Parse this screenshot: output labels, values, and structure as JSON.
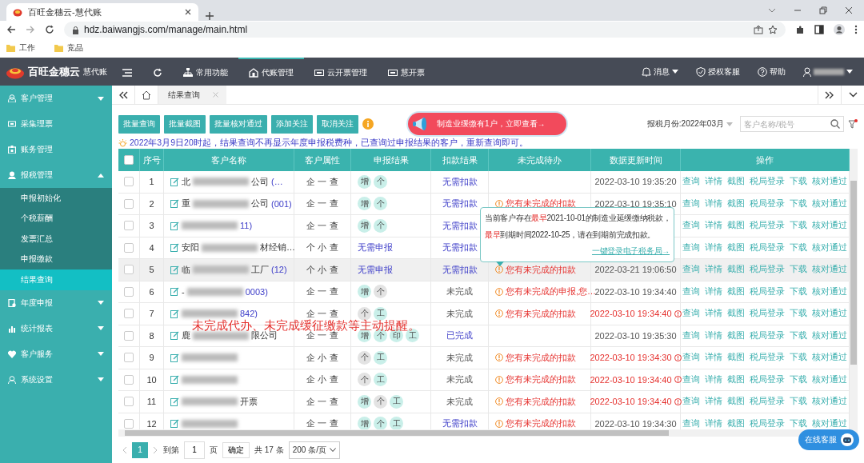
{
  "browser": {
    "tab_title": "百旺金穗云-慧代账",
    "url": "hdz.baiwangjs.com/manage/main.html",
    "bookmarks": [
      "工作",
      "竞品"
    ]
  },
  "header": {
    "brand": "百旺金穗云",
    "product": "慧代账",
    "nav": [
      {
        "label": "常用功能",
        "selected": false
      },
      {
        "label": "代账管理",
        "selected": true
      },
      {
        "label": "云开票管理",
        "selected": false
      },
      {
        "label": "慧开票",
        "selected": false
      }
    ],
    "right": [
      "消息",
      "授权客服",
      "帮助"
    ]
  },
  "sidebar": {
    "items": [
      {
        "label": "客户管理",
        "kind": "group",
        "expanded": false
      },
      {
        "label": "采集理票",
        "kind": "link"
      },
      {
        "label": "账务管理",
        "kind": "link"
      },
      {
        "label": "报税管理",
        "kind": "group",
        "expanded": true,
        "children": [
          {
            "label": "申报初始化",
            "selected": false
          },
          {
            "label": "个税薪酬",
            "selected": false
          },
          {
            "label": "发票汇总",
            "selected": false
          },
          {
            "label": "申报缴款",
            "selected": false
          },
          {
            "label": "结果查询",
            "selected": true
          }
        ]
      },
      {
        "label": "年度申报",
        "kind": "group",
        "expanded": false
      },
      {
        "label": "统计报表",
        "kind": "group",
        "expanded": false
      },
      {
        "label": "客户服务",
        "kind": "group",
        "expanded": false
      },
      {
        "label": "系统设置",
        "kind": "group",
        "expanded": false
      }
    ]
  },
  "tabs": [
    {
      "label": "结果查询",
      "selected": true
    }
  ],
  "toolbar": {
    "buttons": [
      "批量查询",
      "批量截图",
      "批量核对通过",
      "添加关注",
      "取消关注"
    ],
    "banner": "制造业缓缴有1户，立即查看→",
    "month_label": "报税月份:2022年03月",
    "search": {
      "placeholder": "客户名称/税号"
    }
  },
  "notice": "2022年3月9日20时起，结果查询不再显示年度申报税费种，已查询过申报结果的客户，重新查询即可。",
  "table": {
    "columns": [
      "序号",
      "客户名称",
      "客户属性",
      "申报结果",
      "扣款结果",
      "未完成待办",
      "数据更新时间",
      "操作"
    ],
    "header_checked": false,
    "rows": [
      {
        "no": "1",
        "name_head": "北",
        "name_tail": "公司",
        "code": "(…",
        "attr": "企 一 查",
        "tags": [
          {
            "text": "增",
            "color": "#c9efe9"
          },
          {
            "text": "个",
            "color": "#c9efe9"
          }
        ],
        "payment": "无需扣款",
        "done": true,
        "pending": "",
        "time": "2022-03-10 19:35:20",
        "overdue": false,
        "highlighted": false,
        "checked": false,
        "actions": [
          "查询",
          "详情",
          "截图",
          "税局登录",
          "下载",
          "核对通过"
        ]
      },
      {
        "no": "2",
        "name_head": "重",
        "name_tail": "公司",
        "code": "(001)",
        "attr": "企 一 查",
        "tags": [
          {
            "text": "增",
            "color": "#c9efe9"
          },
          {
            "text": "个",
            "color": "#c9efe9"
          }
        ],
        "payment": "无需扣款",
        "done": true,
        "pending": "您有未完成的扣款",
        "time": "2022-03-10 19:35:10",
        "overdue": false,
        "highlighted": false,
        "checked": false,
        "actions": [
          "查询",
          "详情",
          "截图",
          "税局登录",
          "下载",
          "核对通过"
        ]
      },
      {
        "no": "3",
        "name_head": "",
        "name_tail": "",
        "code": "11)",
        "attr": "企 一 查",
        "tags": [
          {
            "text": "增",
            "color": "#c9efe9"
          },
          {
            "text": "个",
            "color": "#c9efe9"
          }
        ],
        "payment": "无需扣款",
        "done": true,
        "pending": "",
        "time": "",
        "highlighted": false,
        "checked": false,
        "actions": [
          "查询",
          "详情",
          "截图",
          "税局登录",
          "下载",
          "核对通过"
        ]
      },
      {
        "no": "4",
        "name_head": "安阳",
        "name_tail": "材经销…",
        "code": "",
        "attr": "个 小 查",
        "report": "无需申报",
        "tags": [],
        "payment": "无需扣款",
        "done": true,
        "pending": "",
        "time": "",
        "highlighted": false,
        "checked": false,
        "actions": [
          "查询",
          "详情",
          "截图",
          "税局登录",
          "下载",
          "核对通过"
        ]
      },
      {
        "no": "5",
        "name_head": "临",
        "name_tail": "工厂",
        "code": "(12)",
        "attr": "个 小 查",
        "report": "无需申报",
        "tags": [],
        "payment": "无需扣款",
        "done": true,
        "pending": "您有未完成的扣款",
        "time": "2022-03-21 19:06:50",
        "overdue": false,
        "highlighted": true,
        "checked": false,
        "actions": [
          "查询",
          "详情",
          "截图",
          "税局登录",
          "下载",
          "核对通过"
        ]
      },
      {
        "no": "6",
        "name_head": "-",
        "name_tail": "",
        "code": "0003)",
        "attr": "企 一 查",
        "tags": [
          {
            "text": "增",
            "color": "#c9efe9"
          },
          {
            "text": "个",
            "color": "#e3e3e3"
          }
        ],
        "payment": "未完成",
        "done": false,
        "pending": "您有未完成的申报,您…",
        "time": "2022-03-10 19:34:40",
        "overdue": false,
        "highlighted": false,
        "checked": false,
        "actions": [
          "查询",
          "详情",
          "截图",
          "税局登录",
          "下载",
          "核对通过"
        ]
      },
      {
        "no": "7",
        "name_head": "",
        "name_tail": "",
        "code": "842)",
        "attr": "企 一 查",
        "tags": [
          {
            "text": "个",
            "color": "#e3e3e3"
          },
          {
            "text": "工",
            "color": "#c9efe9"
          }
        ],
        "payment": "未完成",
        "done": false,
        "pending": "您有未完成的扣款",
        "time": "2022-03-10 19:34:40",
        "overdue": true,
        "highlighted": false,
        "checked": false,
        "actions": [
          "查询",
          "详情",
          "截图",
          "税局登录",
          "下载",
          "核对通过"
        ]
      },
      {
        "no": "8",
        "name_head": "鹿",
        "name_tail": "限公司",
        "code": "",
        "attr": "企 一 查",
        "tags": [
          {
            "text": "增",
            "color": "#c9efe9"
          },
          {
            "text": "个",
            "color": "#c9efe9"
          },
          {
            "text": "印",
            "color": "#c9efe9"
          },
          {
            "text": "工",
            "color": "#c9efe9"
          }
        ],
        "payment": "已完成",
        "done": true,
        "pending": "",
        "time": "2022-03-10 19:35:30",
        "overdue": false,
        "highlighted": false,
        "checked": false,
        "actions": [
          "查询",
          "详情",
          "截图",
          "税局登录",
          "下载",
          "核对通过"
        ]
      },
      {
        "no": "9",
        "name_head": "",
        "name_tail": "",
        "code": "",
        "attr": "企 小 查",
        "tags": [
          {
            "text": "个",
            "color": "#e3e3e3"
          },
          {
            "text": "工",
            "color": "#c9efe9"
          }
        ],
        "payment": "未完成",
        "done": false,
        "pending": "您有未完成的扣款",
        "time": "2022-03-10 19:34:30",
        "overdue": true,
        "highlighted": false,
        "checked": false,
        "actions": [
          "查询",
          "详情",
          "截图",
          "税局登录",
          "下载",
          "核对通过"
        ]
      },
      {
        "no": "10",
        "name_head": "",
        "name_tail": "",
        "code": "",
        "attr": "企 小 查",
        "tags": [
          {
            "text": "个",
            "color": "#e3e3e3"
          },
          {
            "text": "工",
            "color": "#c9efe9"
          }
        ],
        "payment": "未完成",
        "done": false,
        "pending": "您有未完成的扣款",
        "time": "2022-03-10 19:34:40",
        "overdue": true,
        "highlighted": false,
        "checked": false,
        "actions": [
          "查询",
          "详情",
          "截图",
          "税局登录",
          "下载",
          "核对通过"
        ]
      },
      {
        "no": "11",
        "name_head": "",
        "name_tail": "开票",
        "code": "",
        "attr": "企 一 查",
        "tags": [
          {
            "text": "增",
            "color": "#c9efe9"
          },
          {
            "text": "个",
            "color": "#e3e3e3"
          },
          {
            "text": "工",
            "color": "#c9efe9"
          }
        ],
        "payment": "未完成",
        "done": false,
        "pending": "您有未完成的扣款",
        "time": "2022-03-10 19:34:40",
        "overdue": true,
        "highlighted": false,
        "checked": false,
        "actions": [
          "查询",
          "详情",
          "截图",
          "税局登录",
          "下载",
          "核对通过"
        ]
      },
      {
        "no": "12",
        "name_head": "",
        "name_tail": "",
        "code": "",
        "attr": "企 一 查",
        "tags": [
          {
            "text": "增",
            "color": "#c9efe9"
          },
          {
            "text": "个",
            "color": "#c9efe9"
          },
          {
            "text": "工",
            "color": "#c9efe9"
          }
        ],
        "payment": "无需扣款",
        "done": true,
        "pending": "您有未完成的扣款",
        "time": "2022-03-10 19:34:30",
        "overdue": false,
        "highlighted": false,
        "checked": false,
        "actions": [
          "查询",
          "详情",
          "截图",
          "税局登录",
          "下载",
          "核对通过"
        ]
      }
    ]
  },
  "tooltip": {
    "lines": [
      "当前客户存在**最早**2021-10-01的制造业延缓缴纳税款，",
      "**最早**到期时间2022-10-25，请在到期前完成扣款。"
    ],
    "link": "一键登录电子税务局→"
  },
  "pagination": {
    "current": "1",
    "goto_label": "到第",
    "goto_value": "1",
    "page_unit": "页",
    "confirm": "确定",
    "total": "共 17 条",
    "page_size": "200 条/页"
  },
  "annotation": "未完成代办、未完成缓征缴款等主动提醒。",
  "chat_button": "在线客服"
}
